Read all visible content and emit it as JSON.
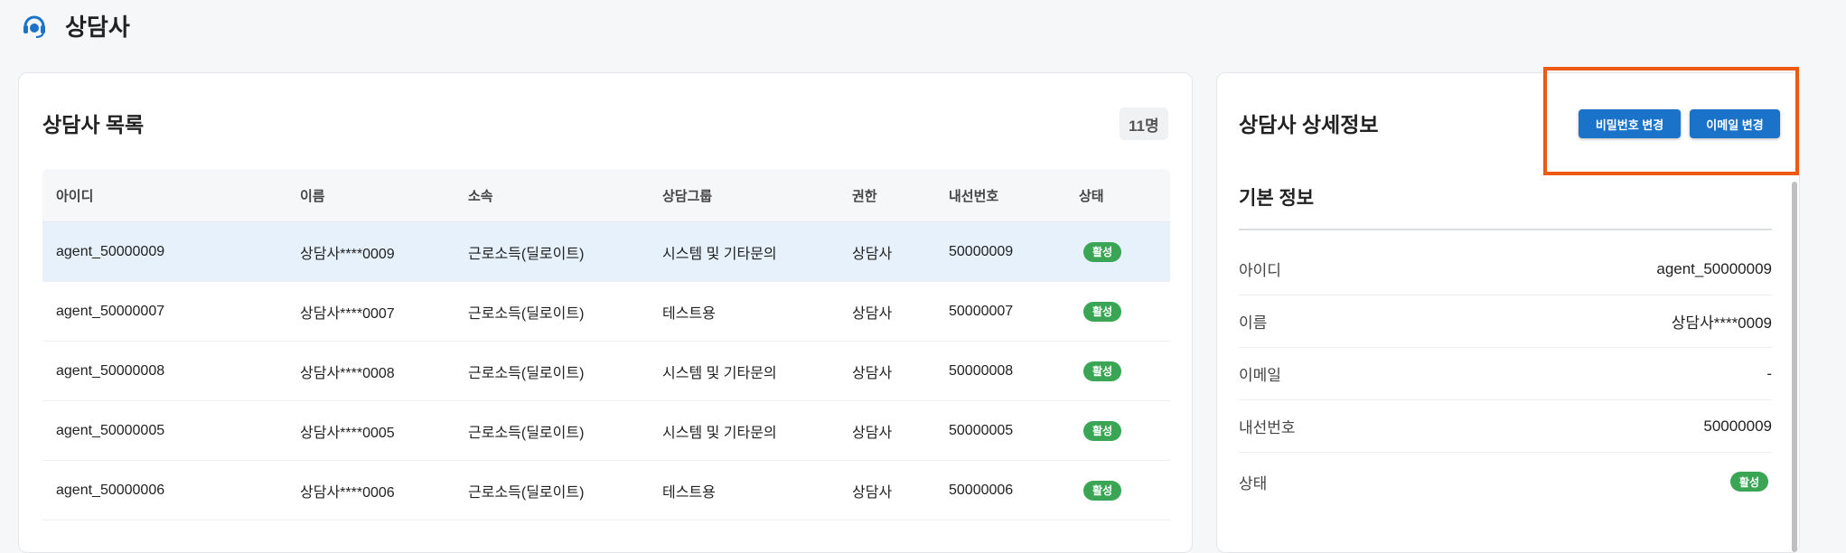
{
  "header": {
    "title": "상담사",
    "icon": "headset-icon"
  },
  "list": {
    "title": "상담사 목록",
    "count": "11명",
    "columns": [
      "아이디",
      "이름",
      "소속",
      "상담그룹",
      "권한",
      "내선번호",
      "상태"
    ],
    "rows": [
      [
        "agent_50000009",
        "상담사****0009",
        "근로소득(딜로이트)",
        "시스템 및 기타문의",
        "상담사",
        "50000009",
        "활성"
      ],
      [
        "agent_50000007",
        "상담사****0007",
        "근로소득(딜로이트)",
        "테스트용",
        "상담사",
        "50000007",
        "활성"
      ],
      [
        "agent_50000008",
        "상담사****0008",
        "근로소득(딜로이트)",
        "시스템 및 기타문의",
        "상담사",
        "50000008",
        "활성"
      ],
      [
        "agent_50000005",
        "상담사****0005",
        "근로소득(딜로이트)",
        "시스템 및 기타문의",
        "상담사",
        "50000005",
        "활성"
      ],
      [
        "agent_50000006",
        "상담사****0006",
        "근로소득(딜로이트)",
        "테스트용",
        "상담사",
        "50000006",
        "활성"
      ]
    ]
  },
  "detail": {
    "title": "상담사 상세정보",
    "change_password_label": "비밀번호 변경",
    "change_email_label": "이메일 변경",
    "section_title": "기본 정보",
    "fields": [
      {
        "label": "아이디",
        "value": "agent_50000009"
      },
      {
        "label": "이름",
        "value": "상담사****0009"
      },
      {
        "label": "이메일",
        "value": "-"
      },
      {
        "label": "내선번호",
        "value": "50000009"
      },
      {
        "label": "상태",
        "value": "활성"
      }
    ]
  },
  "colors": {
    "accent": "#1a73c9",
    "active_pill": "#3aa655",
    "highlight_box": "#ee5a13",
    "selected_row": "#e6f1fc"
  }
}
